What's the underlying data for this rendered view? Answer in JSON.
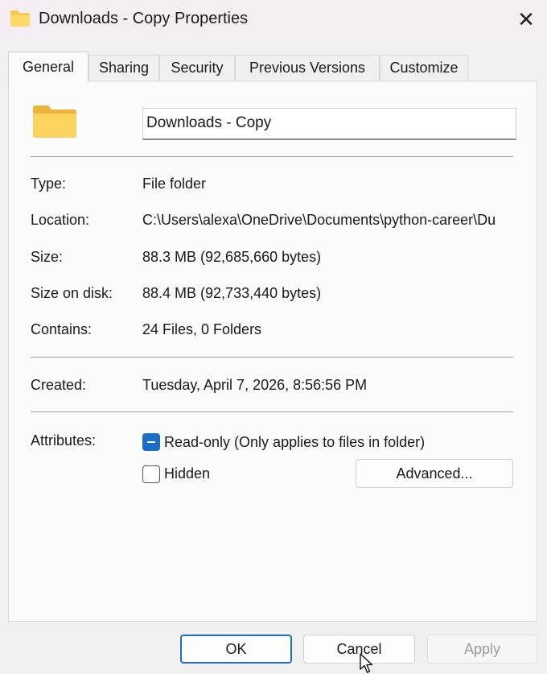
{
  "window": {
    "title": "Downloads - Copy Properties",
    "close_label": "✕"
  },
  "tabs": [
    {
      "label": "General",
      "active": true
    },
    {
      "label": "Sharing",
      "active": false
    },
    {
      "label": "Security",
      "active": false
    },
    {
      "label": "Previous Versions",
      "active": false
    },
    {
      "label": "Customize",
      "active": false
    }
  ],
  "general": {
    "folder_name": "Downloads - Copy",
    "rows": [
      {
        "label": "Type:",
        "value": "File folder"
      },
      {
        "label": "Location:",
        "value": "C:\\Users\\alexa\\OneDrive\\Documents\\python-career\\Du"
      },
      {
        "label": "Size:",
        "value": "88.3 MB (92,685,660 bytes)"
      },
      {
        "label": "Size on disk:",
        "value": "88.4 MB (92,733,440 bytes)"
      },
      {
        "label": "Contains:",
        "value": "24 Files, 0 Folders"
      }
    ],
    "created": {
      "label": "Created:",
      "value": "Tuesday, April 7, 2026, 8:56:56 PM"
    },
    "attributes": {
      "label": "Attributes:",
      "readonly_label": "Read-only (Only applies to files in folder)",
      "readonly_state": "indeterminate",
      "hidden_label": "Hidden",
      "hidden_state": "unchecked",
      "advanced_label": "Advanced..."
    }
  },
  "footer": {
    "ok_label": "OK",
    "cancel_label": "Cancel",
    "apply_label": "Apply"
  },
  "colors": {
    "accent": "#1a6fc4",
    "folder": "#f8c94a"
  },
  "icons": {
    "title": "folder-icon",
    "main": "folder-icon",
    "close": "close-icon",
    "cursor": "mouse-pointer-icon"
  }
}
